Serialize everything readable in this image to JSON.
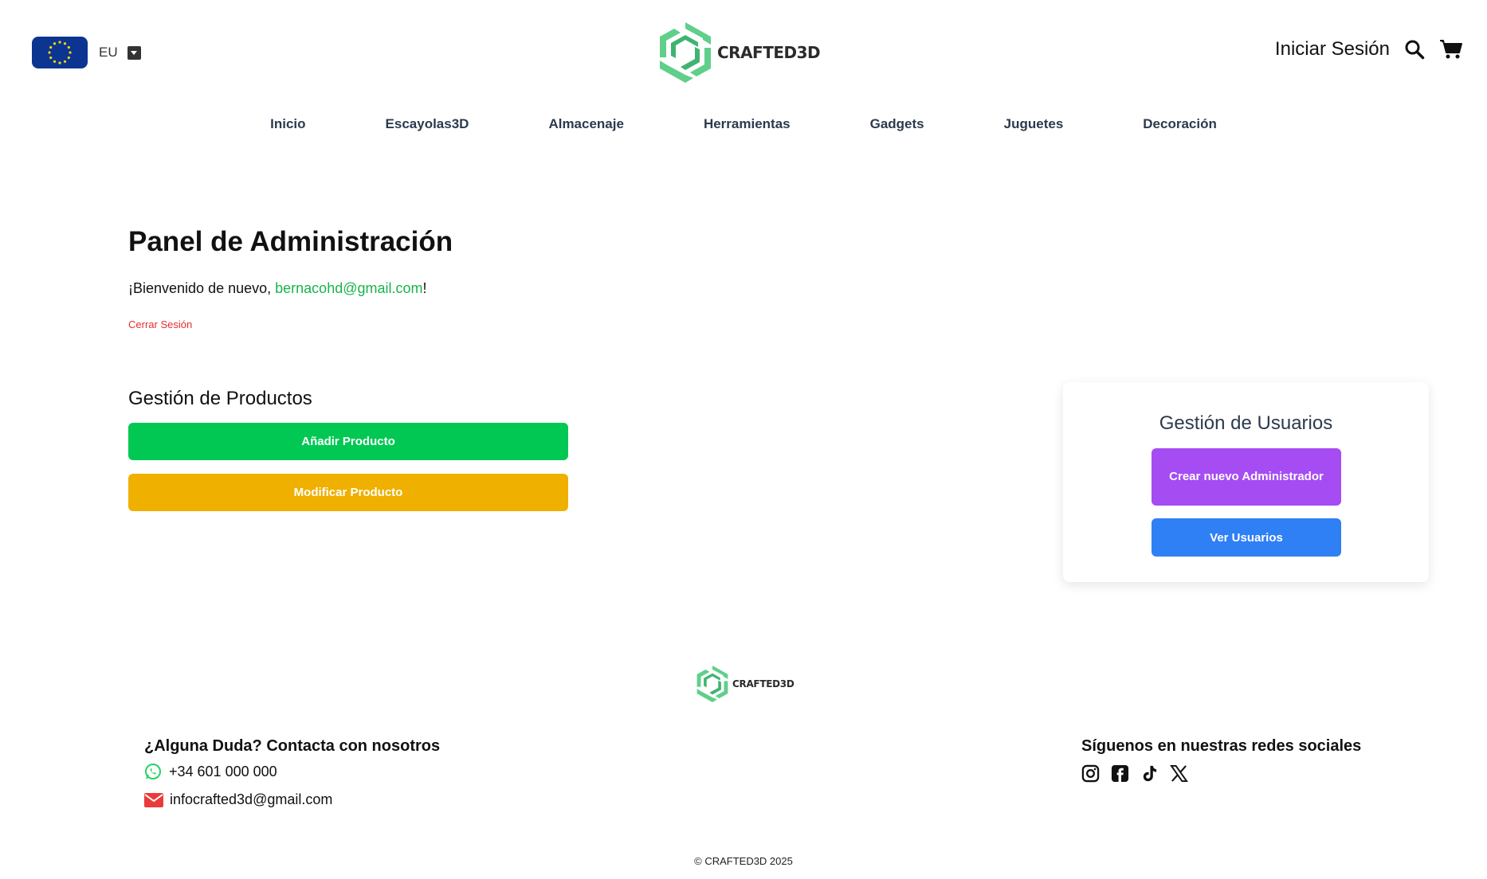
{
  "header": {
    "language_code": "EU",
    "brand_name": "CRAFTED3D",
    "login_label": "Iniciar Sesión",
    "icons": [
      "eu-flag-icon",
      "caret-down-icon",
      "search-icon",
      "cart-icon"
    ]
  },
  "nav": {
    "items": [
      {
        "label": "Inicio"
      },
      {
        "label": "Escayolas3D"
      },
      {
        "label": "Almacenaje"
      },
      {
        "label": "Herramientas"
      },
      {
        "label": "Gadgets"
      },
      {
        "label": "Juguetes"
      },
      {
        "label": "Decoración"
      }
    ]
  },
  "main": {
    "title": "Panel de Administración",
    "welcome_prefix": "¡Bienvenido de nuevo, ",
    "welcome_email": "bernacohd@gmail.com",
    "welcome_suffix": "!",
    "logout_label": "Cerrar Sesión",
    "products": {
      "title": "Gestión de Productos",
      "add_label": "Añadir Producto",
      "modify_label": "Modificar Producto"
    },
    "users": {
      "title": "Gestión de Usuarios",
      "create_admin_label": "Crear nuevo Administrador",
      "view_users_label": "Ver Usuarios"
    }
  },
  "footer": {
    "brand_name": "CRAFTED3D",
    "contact_title": "¿Alguna Duda? Contacta con nosotros",
    "phone": "+34 601 000 000",
    "email": "infocrafted3d@gmail.com",
    "social_title": "Síguenos en nuestras redes sociales",
    "social_icons": [
      "instagram-icon",
      "facebook-icon",
      "tiktok-icon",
      "x-icon"
    ],
    "copyright": "© CRAFTED3D 2025"
  },
  "colors": {
    "brand_green": "#5fcf8a",
    "email_link": "#19b34a",
    "logout_red": "#e62e2e",
    "add_button": "#00c853",
    "modify_button": "#efb000",
    "create_admin_button": "#a54cf3",
    "view_users_button": "#2f7ff5",
    "flag_blue": "#0c3592",
    "whatsapp_green": "#25d366",
    "mail_red": "#ea3b3b"
  }
}
